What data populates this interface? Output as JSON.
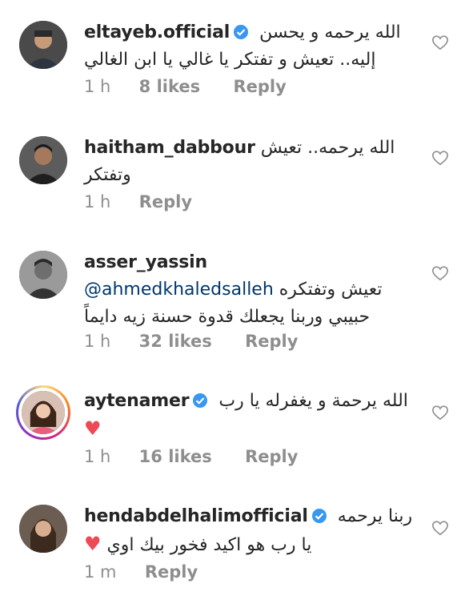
{
  "comments": [
    {
      "username": "eltayeb.official",
      "verified": true,
      "text_line1": "الله يرحمه و يحسن",
      "text_line2": "إليه.. تعيش و تفتكر يا غالي يا ابن الغالي",
      "time": "1 h",
      "likes": "8 likes",
      "reply": "Reply"
    },
    {
      "username": "haitham_dabbour",
      "verified": false,
      "text_line1": "الله يرحمه.. تعيش",
      "text_line2": "وتفتكر",
      "time": "1 h",
      "reply": "Reply"
    },
    {
      "username": "asser_yassin",
      "verified": false,
      "mention": "@ahmedkhaledsalleh",
      "text_line1": "تعيش وتفتكره",
      "text_line2": "حبيبي وربنا يجعلك قدوة حسنة زيه دايماً",
      "time": "1 h",
      "likes": "32 likes",
      "reply": "Reply"
    },
    {
      "username": "aytenamer",
      "verified": true,
      "text_line1": "الله يرحمة و يغفرله يا رب",
      "emoji": "♥",
      "time": "1 h",
      "likes": "16 likes",
      "reply": "Reply"
    },
    {
      "username": "hendabdelhalimofficial",
      "verified": true,
      "text_line1": "ربنا يرحمه",
      "text_line2": "يا رب هو اكيد فخور بيك اوي",
      "emoji": "♥",
      "time": "1 m",
      "reply": "Reply"
    }
  ],
  "colors": {
    "text": "#262626",
    "meta": "#8e8e8e",
    "verified_blue": "#3897f0",
    "heart_red": "#ed4956",
    "mention": "#00376b"
  },
  "icons": {
    "like": "heart-outline-icon",
    "verified": "verified-badge-icon"
  }
}
